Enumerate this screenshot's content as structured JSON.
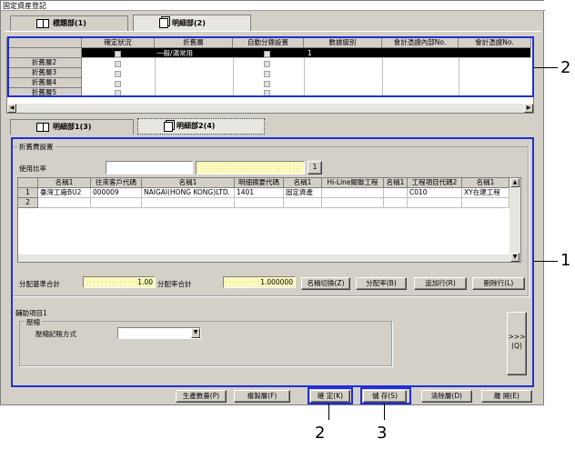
{
  "window": {
    "title": "固定資産登記"
  },
  "tabs_top": [
    {
      "label": "標題部(1)"
    },
    {
      "label": "明細部(2)"
    }
  ],
  "tabs_mid": [
    {
      "label": "明細部1(3)"
    },
    {
      "label": "明細部2(4)"
    }
  ],
  "top_grid": {
    "headers": [
      "確定狀況",
      "折舊層",
      "自動分錄設置",
      "數據級別",
      "會計憑證內部No.",
      "會計憑證No."
    ],
    "rows": [
      {
        "label": "",
        "col2": "一般/滿常用",
        "col4": "1"
      },
      {
        "label": "折舊層2"
      },
      {
        "label": "折舊層3"
      },
      {
        "label": "折舊層4"
      },
      {
        "label": "折舊層5"
      }
    ]
  },
  "depr_settings": {
    "group_label": "折舊費設置",
    "usage_ratio_label": "使用比率",
    "button_1": "1",
    "headers": [
      "名稱1",
      "往來客戶代碼",
      "名稱1",
      "明細摘要代碼",
      "名稱1",
      "Hi-Line關聯工程",
      "名稱1",
      "工程項目代碼2",
      "名稱1"
    ],
    "rows": [
      {
        "no": "1",
        "c1": "臺灣工廠BU2",
        "c2": "000009",
        "c3": "NAIGAI(HONG KONG)LTD.",
        "c4": "1401",
        "c5": "固定資產",
        "c6": "",
        "c7": "",
        "c8": "C010",
        "c9": "XY在建工程"
      },
      {
        "no": "2",
        "c1": "",
        "c2": "",
        "c3": "",
        "c4": "",
        "c5": "",
        "c6": "",
        "c7": "",
        "c8": "",
        "c9": ""
      }
    ],
    "alloc_base_label": "分配基準合計",
    "alloc_base_value": "1.00",
    "alloc_rate_label": "分配率合計",
    "alloc_rate_value": "1.000000",
    "buttons": [
      "名稱切換(Z)",
      "分配率(B)",
      "追加行(R)",
      "刪除行(L)"
    ]
  },
  "aux": {
    "group_label": "輔助項目1",
    "sub_label": "壓縮",
    "method_label": "壓縮記賬方式",
    "expand_button": ">>>\n(Q)"
  },
  "bottom_buttons": [
    "生產數量(P)",
    "複製層(F)",
    "確 定(K)",
    "儲 存(S)",
    "清除層(D)",
    "離 開(E)"
  ],
  "callouts": [
    "2",
    "1",
    "2",
    "3"
  ],
  "colors": {
    "accent": "#1f2fd8",
    "face": "#d4d0c8"
  }
}
